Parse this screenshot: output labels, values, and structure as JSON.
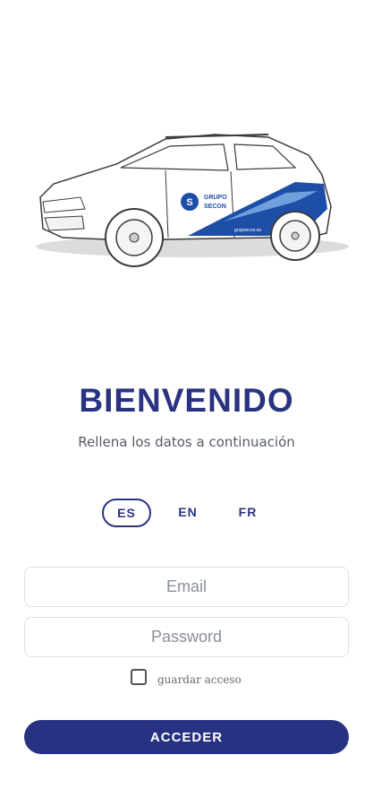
{
  "hero": {
    "illustration": "car-with-grupo-secon-livery",
    "brand_text_line1": "GRUPO",
    "brand_text_line2": "SECON",
    "brand_url": "grupsecon.es",
    "colors": {
      "livery_blue": "#1e4fa8",
      "livery_light": "#6fa0dc"
    }
  },
  "welcome": {
    "title": "BIENVENIDO",
    "subtitle": "Rellena los datos a continuación"
  },
  "languages": {
    "es": "ES",
    "en": "EN",
    "fr": "FR",
    "selected": "ES"
  },
  "form": {
    "email_placeholder": "Email",
    "password_placeholder": "Password",
    "remember_label": "guardar acceso",
    "remember_checked": false,
    "submit_label": "ACCEDER"
  },
  "colors": {
    "primary": "#2a3382",
    "field_border": "#dfe1e6"
  }
}
